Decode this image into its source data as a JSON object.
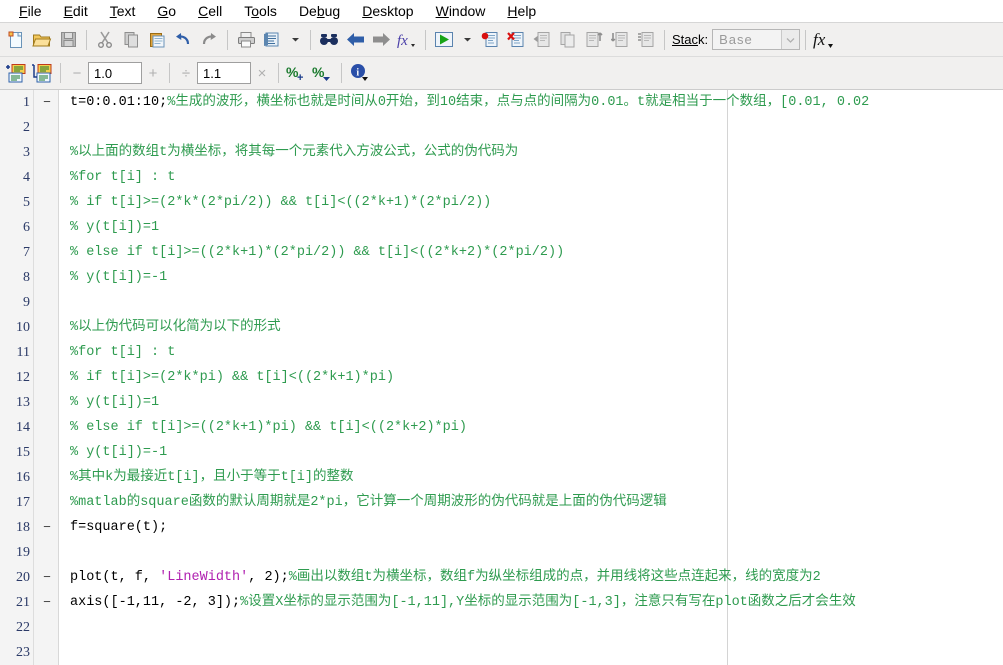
{
  "window": {
    "app": "MATLAB Editor"
  },
  "menubar": {
    "items": [
      {
        "label": "File",
        "mnemonic_index": 0
      },
      {
        "label": "Edit",
        "mnemonic_index": 0
      },
      {
        "label": "Text",
        "mnemonic_index": 0
      },
      {
        "label": "Go",
        "mnemonic_index": 0
      },
      {
        "label": "Cell",
        "mnemonic_index": 0
      },
      {
        "label": "Tools",
        "mnemonic_index": 1
      },
      {
        "label": "Debug",
        "mnemonic_index": 2
      },
      {
        "label": "Desktop",
        "mnemonic_index": 0
      },
      {
        "label": "Window",
        "mnemonic_index": 0
      },
      {
        "label": "Help",
        "mnemonic_index": 0
      }
    ]
  },
  "toolbar_main": {
    "icons": [
      "new-file-icon",
      "open-folder-icon",
      "save-icon",
      "cut-icon",
      "copy-icon",
      "paste-icon",
      "undo-icon",
      "redo-icon",
      "print-icon",
      "publish-icon",
      "publish-dropdown-icon",
      "find-icon",
      "back-arrow-icon",
      "forward-arrow-icon",
      "function-browser-icon",
      "run-icon",
      "run-dropdown-icon",
      "set-breakpoint-icon",
      "clear-breakpoints-icon",
      "step-in-icon",
      "step-icon",
      "step-out-icon",
      "continue-icon",
      "exit-debug-icon"
    ],
    "stack_label": "Stack:",
    "stack_mnemonic_index": 4,
    "stack_value": "Base",
    "fx_label": "fx"
  },
  "toolbar_cell": {
    "icons": [
      "insert-cell-icon",
      "insert-cell-break-icon",
      "comment-increase-icon",
      "comment-decrease-icon",
      "info-icon"
    ],
    "minus_label": "−",
    "divide_value": "1.0",
    "plus_label": "+",
    "divide_label": "÷",
    "multiply_value": "1.1",
    "multiply_label": "×"
  },
  "editor": {
    "text_limit_column_x": 727,
    "lines": [
      {
        "number": "1",
        "breakpoint": "−",
        "segments": [
          {
            "text": "t=0:0.01:10;",
            "style": "code"
          },
          {
            "text": "%生成的波形，横坐标也就是时间从0开始，到10结束，点与点的间隔为0.01。t就是相当于一个数组，[0.01, 0.02",
            "style": "comment"
          }
        ]
      },
      {
        "number": "2",
        "breakpoint": "",
        "segments": []
      },
      {
        "number": "3",
        "breakpoint": "",
        "segments": [
          {
            "text": "%以上面的数组t为横坐标，将其每一个元素代入方波公式，公式的伪代码为",
            "style": "comment"
          }
        ]
      },
      {
        "number": "4",
        "breakpoint": "",
        "segments": [
          {
            "text": "%for t[i] : t",
            "style": "comment"
          }
        ]
      },
      {
        "number": "5",
        "breakpoint": "",
        "segments": [
          {
            "text": "%   if t[i]>=(2*k*(2*pi/2)) && t[i]<((2*k+1)*(2*pi/2))",
            "style": "comment"
          }
        ]
      },
      {
        "number": "6",
        "breakpoint": "",
        "segments": [
          {
            "text": "%       y(t[i])=1",
            "style": "comment"
          }
        ]
      },
      {
        "number": "7",
        "breakpoint": "",
        "segments": [
          {
            "text": "%   else if t[i]>=((2*k+1)*(2*pi/2)) && t[i]<((2*k+2)*(2*pi/2))",
            "style": "comment"
          }
        ]
      },
      {
        "number": "8",
        "breakpoint": "",
        "segments": [
          {
            "text": "%       y(t[i])=-1",
            "style": "comment"
          }
        ]
      },
      {
        "number": "9",
        "breakpoint": "",
        "segments": []
      },
      {
        "number": "10",
        "breakpoint": "",
        "segments": [
          {
            "text": "%以上伪代码可以化简为以下的形式",
            "style": "comment"
          }
        ]
      },
      {
        "number": "11",
        "breakpoint": "",
        "segments": [
          {
            "text": "%for t[i] : t",
            "style": "comment"
          }
        ]
      },
      {
        "number": "12",
        "breakpoint": "",
        "segments": [
          {
            "text": "%   if t[i]>=(2*k*pi) && t[i]<((2*k+1)*pi)",
            "style": "comment"
          }
        ]
      },
      {
        "number": "13",
        "breakpoint": "",
        "segments": [
          {
            "text": "%       y(t[i])=1",
            "style": "comment"
          }
        ]
      },
      {
        "number": "14",
        "breakpoint": "",
        "segments": [
          {
            "text": "%   else if t[i]>=((2*k+1)*pi) && t[i]<((2*k+2)*pi)",
            "style": "comment"
          }
        ]
      },
      {
        "number": "15",
        "breakpoint": "",
        "segments": [
          {
            "text": "%       y(t[i])=-1",
            "style": "comment"
          }
        ]
      },
      {
        "number": "16",
        "breakpoint": "",
        "segments": [
          {
            "text": "%其中k为最接近t[i]，且小于等于t[i]的整数",
            "style": "comment"
          }
        ]
      },
      {
        "number": "17",
        "breakpoint": "",
        "segments": [
          {
            "text": "%matlab的square函数的默认周期就是2*pi，它计算一个周期波形的伪代码就是上面的伪代码逻辑",
            "style": "comment"
          }
        ]
      },
      {
        "number": "18",
        "breakpoint": "−",
        "segments": [
          {
            "text": "f=square(t);",
            "style": "code"
          }
        ]
      },
      {
        "number": "19",
        "breakpoint": "",
        "segments": []
      },
      {
        "number": "20",
        "breakpoint": "−",
        "segments": [
          {
            "text": "plot(t, f, ",
            "style": "code"
          },
          {
            "text": "'LineWidth'",
            "style": "string"
          },
          {
            "text": ", 2);",
            "style": "code"
          },
          {
            "text": "%画出以数组t为横坐标，数组f为纵坐标组成的点，并用线将这些点连起来，线的宽度为2",
            "style": "comment"
          }
        ]
      },
      {
        "number": "21",
        "breakpoint": "−",
        "segments": [
          {
            "text": "axis([-1,11, -2, 3]);",
            "style": "code"
          },
          {
            "text": "%设置X坐标的显示范围为[-1,11],Y坐标的显示范围为[-1,3]，注意只有写在plot函数之后才会生效",
            "style": "comment"
          }
        ]
      },
      {
        "number": "22",
        "breakpoint": "",
        "segments": []
      },
      {
        "number": "23",
        "breakpoint": "",
        "segments": []
      }
    ]
  },
  "colors": {
    "comment": "#2e9b4f",
    "string": "#b020b0",
    "code": "#000000",
    "line_number": "#2b3a67",
    "toolbar_bg": "#f1f0ef",
    "gutter_bg": "#f4f4f4"
  }
}
